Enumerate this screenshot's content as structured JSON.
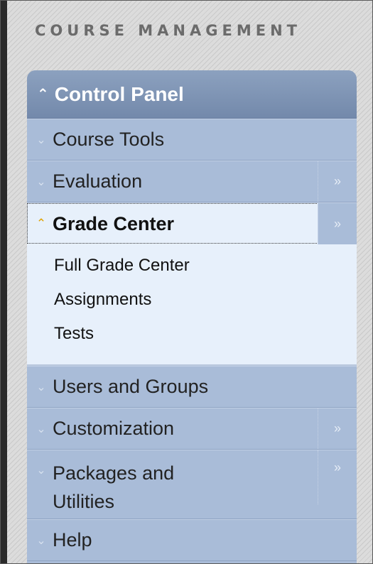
{
  "section_heading": "COURSE MANAGEMENT",
  "control_panel": {
    "title": "Control Panel",
    "items": [
      {
        "label": "Course Tools",
        "has_arrow": false
      },
      {
        "label": "Evaluation",
        "has_arrow": true
      },
      {
        "label": "Grade Center",
        "has_arrow": true,
        "expanded": true,
        "subitems": [
          "Full Grade Center",
          "Assignments",
          "Tests"
        ]
      },
      {
        "label": "Users and Groups",
        "has_arrow": false
      },
      {
        "label": "Customization",
        "has_arrow": true
      },
      {
        "label": "Packages and Utilities",
        "label_line1": "Packages and",
        "label_line2": "Utilities",
        "has_arrow": true
      },
      {
        "label": "Help",
        "has_arrow": false
      }
    ]
  },
  "icons": {
    "collapsed": "chevron-down-icon",
    "expanded": "chevron-up-icon",
    "flyout": "double-chevron-right-icon"
  },
  "colors": {
    "panel_bg": "#a9bcd8",
    "header_bg": "#7f94b5",
    "expanded_bg": "#e7f0fb",
    "expanded_chevron": "#e0a200"
  }
}
